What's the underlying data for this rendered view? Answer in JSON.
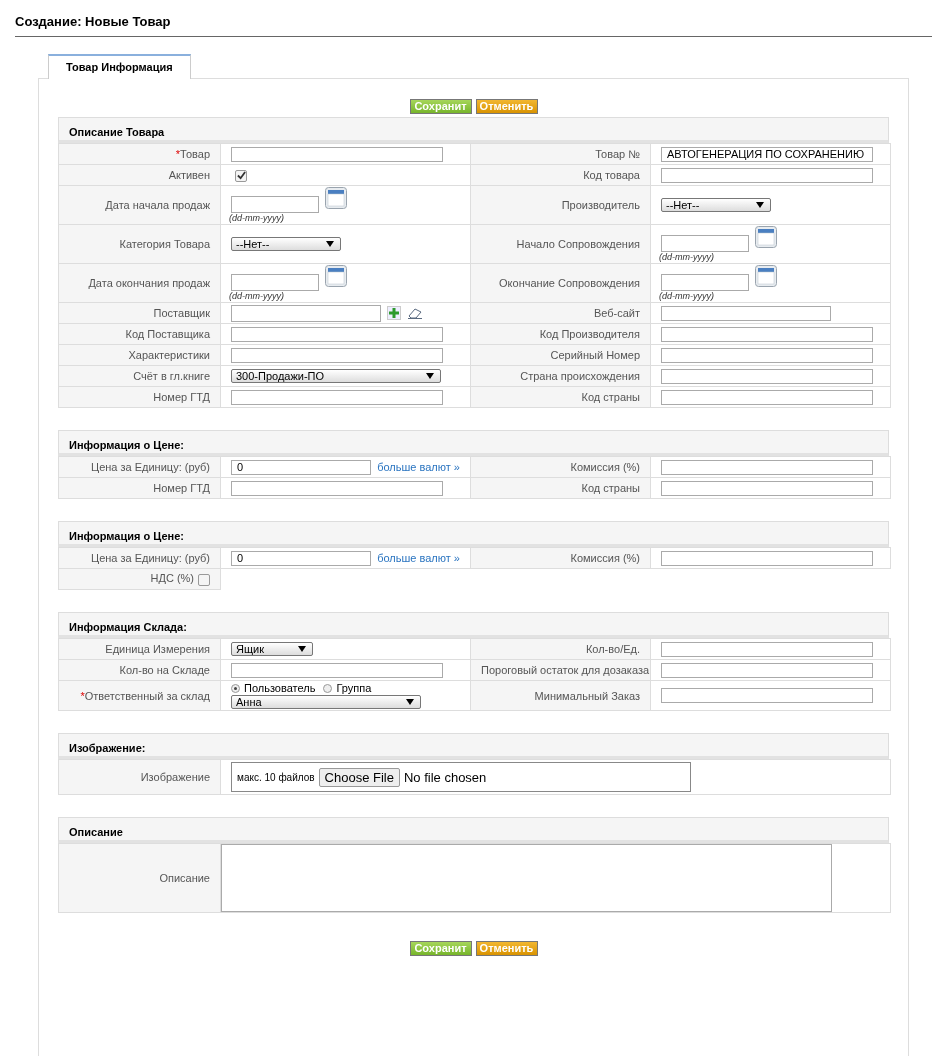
{
  "page_title": "Создание: Новые Товар",
  "tabs": [
    {
      "label": "Товар Информация",
      "selected": true
    }
  ],
  "top_buttons": [
    {
      "label": "Сохранит",
      "kind": "save"
    },
    {
      "label": "Отменить",
      "kind": "cancel"
    }
  ],
  "sections": [
    {
      "title": "Описание Товара",
      "rows": [
        {
          "left": {
            "label": "Товар",
            "mark": "*",
            "field": {
              "kind": "text"
            }
          },
          "right": {
            "label": "Товар №",
            "field": {
              "kind": "text",
              "value": "АВТОГЕНЕРАЦИЯ ПО СОХРАНЕНИЮ"
            }
          }
        },
        {
          "left": {
            "label": "Активен",
            "field": {
              "kind": "checkbox",
              "checked": true
            }
          },
          "right": {
            "label": "Код товара",
            "field": {
              "kind": "text"
            }
          }
        },
        {
          "left": {
            "label": "Дата начала продаж",
            "field": {
              "kind": "date",
              "hint": "(dd-mm-yyyy)"
            }
          },
          "right": {
            "label": "Производитель",
            "field": {
              "kind": "select",
              "value": "--Нет--"
            }
          }
        },
        {
          "left": {
            "label": "Категория Товара",
            "field": {
              "kind": "select",
              "value": "--Нет--"
            }
          },
          "right": {
            "label": "Начало Сопровождения",
            "field": {
              "kind": "date",
              "hint": "(dd-mm-yyyy)"
            }
          }
        },
        {
          "left": {
            "label": "Дата окончания продаж",
            "field": {
              "kind": "date",
              "hint": "(dd-mm-yyyy)"
            }
          },
          "right": {
            "label": "Окончание Сопровождения",
            "field": {
              "kind": "date",
              "hint": "(dd-mm-yyyy)"
            }
          }
        },
        {
          "left": {
            "label": "Поставщик",
            "field": {
              "kind": "lookup"
            }
          },
          "right": {
            "label": "Веб-сайт",
            "field": {
              "kind": "url"
            }
          }
        },
        {
          "left": {
            "label": "Код Поставщика",
            "field": {
              "kind": "text"
            }
          },
          "right": {
            "label": "Код Производителя",
            "field": {
              "kind": "text"
            }
          }
        },
        {
          "left": {
            "label": "Характеристики",
            "field": {
              "kind": "text"
            }
          },
          "right": {
            "label": "Серийный Номер",
            "field": {
              "kind": "text"
            }
          }
        },
        {
          "left": {
            "label": "Счёт в гл.книге",
            "field": {
              "kind": "wide-select",
              "value": "300-Продажи-ПО"
            }
          },
          "right": {
            "label": "Страна происхождения",
            "field": {
              "kind": "text"
            }
          }
        },
        {
          "left": {
            "label": "Номер ГТД",
            "field": {
              "kind": "text"
            }
          },
          "right": {
            "label": "Код страны",
            "field": {
              "kind": "text"
            }
          }
        }
      ]
    },
    {
      "title": "Информация о Цене:",
      "rows": [
        {
          "left": {
            "label": "Цена за Единицу: (руб)",
            "field": {
              "kind": "price",
              "value": "0",
              "link": "больше валют »"
            }
          },
          "right": {
            "label": "Комиссия (%)",
            "field": {
              "kind": "text"
            }
          }
        },
        {
          "left": {
            "label": "Номер ГТД",
            "field": {
              "kind": "text"
            }
          },
          "right": {
            "label": "Код страны",
            "field": {
              "kind": "text"
            }
          }
        }
      ]
    },
    {
      "title": "Информация о Цене:",
      "rows": [
        {
          "left": {
            "label": "Цена за Единицу: (руб)",
            "field": {
              "kind": "price",
              "value": "0",
              "link": "больше валют »"
            }
          },
          "right": {
            "label": "Комиссия (%)",
            "field": {
              "kind": "text"
            }
          }
        },
        {
          "left": {
            "label": "НДС (%)",
            "field": {
              "kind": "inline-checkbox",
              "checked": false
            }
          }
        }
      ]
    },
    {
      "title": "Информация Склада:",
      "rows": [
        {
          "left": {
            "label": "Единица Измерения",
            "field": {
              "kind": "small-select",
              "value": "Ящик"
            }
          },
          "right": {
            "label": "Кол-во/Ед.",
            "field": {
              "kind": "text"
            }
          }
        },
        {
          "left": {
            "label": "Кол-во на Складе",
            "field": {
              "kind": "text"
            }
          },
          "right": {
            "label": "Пороговый остаток для дозаказа",
            "field": {
              "kind": "text"
            }
          }
        },
        {
          "left": {
            "label": "Ответственный за склад",
            "mark": "*",
            "field": {
              "kind": "owner",
              "options": [
                {
                  "label": "Пользователь",
                  "selected": true
                },
                {
                  "label": "Группа",
                  "selected": false
                }
              ],
              "value": "Анна"
            }
          },
          "right": {
            "label": "Минимальный Заказ",
            "field": {
              "kind": "text"
            }
          }
        }
      ]
    },
    {
      "title": "Изображение:",
      "rows": [
        {
          "left": {
            "label": "Изображение",
            "field": {
              "kind": "file",
              "note": "макс. 10 файлов",
              "button": "Choose File",
              "status": "No file chosen"
            }
          }
        }
      ]
    },
    {
      "title": "Описание",
      "rows": [
        {
          "left": {
            "label": "Описание",
            "field": {
              "kind": "textarea"
            }
          }
        }
      ]
    }
  ],
  "bottom_buttons": [
    {
      "label": "Сохранит",
      "kind": "save"
    },
    {
      "label": "Отменить",
      "kind": "cancel"
    }
  ]
}
